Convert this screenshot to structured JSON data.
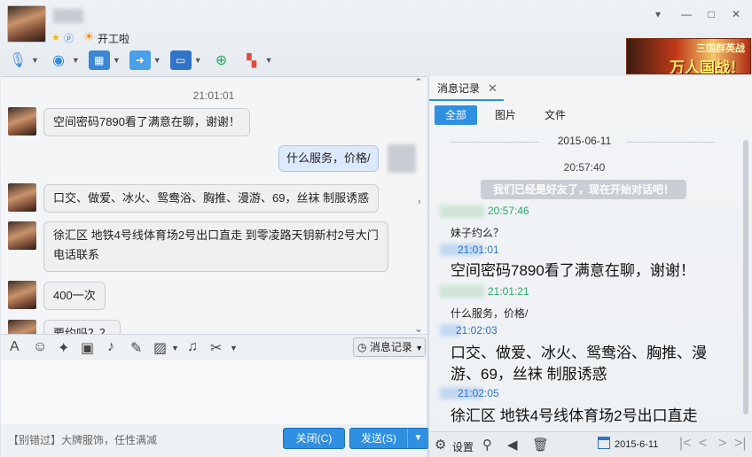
{
  "window": {
    "status_text": "开工啦",
    "buttons": {
      "dropdown": "▾",
      "minimize": "—",
      "maximize": "□",
      "close": "✕"
    }
  },
  "ad": {
    "title": "三国群英战",
    "slogan": "万人国战！"
  },
  "toolbar": {
    "items": [
      {
        "icon": "microphone-icon"
      },
      {
        "icon": "webcam-icon"
      },
      {
        "icon": "screen-share-icon"
      },
      {
        "icon": "file-transfer-icon"
      },
      {
        "icon": "remote-desktop-icon"
      },
      {
        "icon": "add-app-icon"
      },
      {
        "icon": "apps-grid-icon"
      }
    ]
  },
  "chat": {
    "time": "21:01:01",
    "messages": [
      {
        "from": "other",
        "text": "空间密码7890看了满意在聊，谢谢！"
      },
      {
        "from": "self",
        "text": "什么服务，价格/"
      },
      {
        "from": "other",
        "text": "口交、做爱、冰火、鸳鸯浴、胸推、漫游、69，丝袜   制服诱惑"
      },
      {
        "from": "other",
        "line1": "徐汇区  地铁4号线体育场2号出口直走  到零凌路天钥新村2号大门",
        "line2": "电话联系"
      },
      {
        "from": "other",
        "text": "400一次"
      },
      {
        "from": "other",
        "text": "要约吗？？"
      }
    ]
  },
  "input_toolbar": {
    "history_label": "消息记录"
  },
  "bottom": {
    "tip": "【别错过】大牌服饰，任性满减",
    "close_label": "关闭(C)",
    "send_label": "发送(S)"
  },
  "history": {
    "tab_label": "消息记录",
    "filters": [
      "全部",
      "图片",
      "文件"
    ],
    "date": "2015-06-11",
    "sys_time": "20:57:40",
    "sys_msg": "我们已经是好友了，现在开始对话吧！",
    "entries": [
      {
        "time": "20:57:46",
        "text": "妹子约么？"
      },
      {
        "time": "21:01:01",
        "text": "空间密码7890看了满意在聊，谢谢！"
      },
      {
        "time": "21:01:21",
        "text": "什么服务，价格/"
      },
      {
        "time": "21:02:03",
        "text": "口交、做爱、冰火、鸳鸯浴、胸推、漫游、69，丝袜    制服诱惑"
      },
      {
        "time": "21:02:05",
        "text": "徐汇区  地铁4号线体育场2号出口直走"
      }
    ],
    "settings_label": "设置",
    "calendar_date": "2015-6-11"
  },
  "colors": {
    "accent": "#2f8fe0",
    "green_time": "#2aa86a",
    "blue_time": "#2f74c8"
  }
}
